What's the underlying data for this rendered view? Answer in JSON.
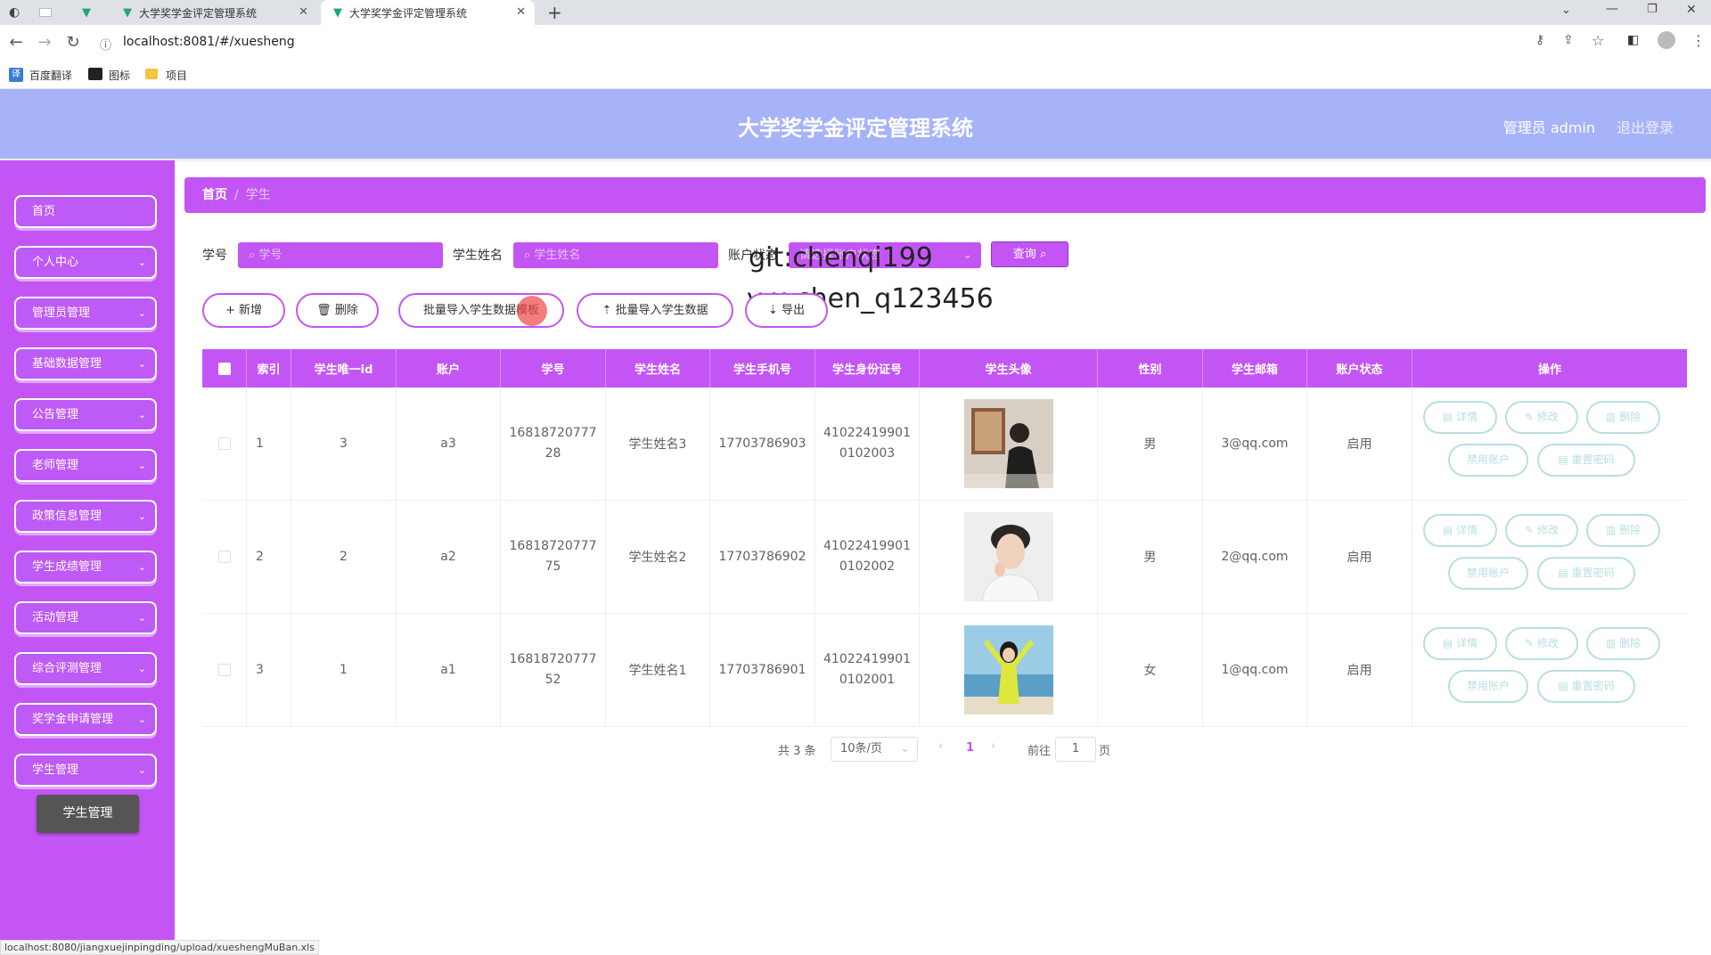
{
  "browser": {
    "tabs": [
      {
        "title": ""
      },
      {
        "title": "大学奖学金评定管理系统"
      },
      {
        "title": "大学奖学金评定管理系统"
      }
    ],
    "url": "localhost:8081/#/xuesheng",
    "bookmarks": [
      "百度翻译",
      "图标",
      "项目"
    ],
    "status_url": "localhost:8080/jiangxuejinpingding/upload/xueshengMuBan.xls"
  },
  "header": {
    "title": "大学奖学金评定管理系统",
    "admin": "管理员 admin",
    "logout": "退出登录"
  },
  "sidebar": {
    "items": [
      {
        "label": "首页",
        "expandable": false
      },
      {
        "label": "个人中心",
        "expandable": true
      },
      {
        "label": "管理员管理",
        "expandable": true
      },
      {
        "label": "基础数据管理",
        "expandable": true
      },
      {
        "label": "公告管理",
        "expandable": true
      },
      {
        "label": "老师管理",
        "expandable": true
      },
      {
        "label": "政策信息管理",
        "expandable": true
      },
      {
        "label": "学生成绩管理",
        "expandable": true
      },
      {
        "label": "活动管理",
        "expandable": true
      },
      {
        "label": "综合评测管理",
        "expandable": true
      },
      {
        "label": "奖学金申请管理",
        "expandable": true
      },
      {
        "label": "学生管理",
        "expandable": true
      }
    ],
    "submenu": "学生管理"
  },
  "breadcrumb": {
    "home": "首页",
    "current": "学生"
  },
  "search": {
    "labels": {
      "xuehao": "学号",
      "name": "学生姓名",
      "status": "账户状态"
    },
    "placeholders": {
      "xuehao": "学号",
      "name": "学生姓名",
      "status": "请选择账户状态"
    },
    "query": "查询"
  },
  "actions": {
    "add": "新增",
    "delete": "删除",
    "template": "批量导入学生数据模板",
    "import": "批量导入学生数据",
    "export": "导出"
  },
  "watermark": [
    "git:chenqi199",
    "v x:chen_q123456"
  ],
  "table": {
    "headers": [
      "索引",
      "学生唯一id",
      "账户",
      "学号",
      "学生姓名",
      "学生手机号",
      "学生身份证号",
      "学生头像",
      "性别",
      "学生邮箱",
      "账户状态",
      "操作"
    ],
    "rows": [
      {
        "index": "1",
        "uid": "3",
        "account": "a3",
        "xuehao1": "16818720777",
        "xuehao2": "28",
        "name": "学生姓名3",
        "phone": "17703786903",
        "id1": "41022419901",
        "id2": "0102003",
        "gender": "男",
        "email": "3@qq.com",
        "status": "启用"
      },
      {
        "index": "2",
        "uid": "2",
        "account": "a2",
        "xuehao1": "16818720777",
        "xuehao2": "75",
        "name": "学生姓名2",
        "phone": "17703786902",
        "id1": "41022419901",
        "id2": "0102002",
        "gender": "男",
        "email": "2@qq.com",
        "status": "启用"
      },
      {
        "index": "3",
        "uid": "1",
        "account": "a1",
        "xuehao1": "16818720777",
        "xuehao2": "52",
        "name": "学生姓名1",
        "phone": "17703786901",
        "id1": "41022419901",
        "id2": "0102001",
        "gender": "女",
        "email": "1@qq.com",
        "status": "启用"
      }
    ],
    "ops": {
      "detail": "详情",
      "edit": "修改",
      "delete": "删除",
      "disable": "禁用账户",
      "reset": "重置密码"
    }
  },
  "pagination": {
    "total": "共 3 条",
    "page_size": "10条/页",
    "current": "1",
    "goto": "前往",
    "goto_value": "1",
    "page_unit": "页"
  },
  "colors": {
    "accent": "#c355f5",
    "header": "#a7b3f8",
    "op_border": "#b7dfe2"
  }
}
